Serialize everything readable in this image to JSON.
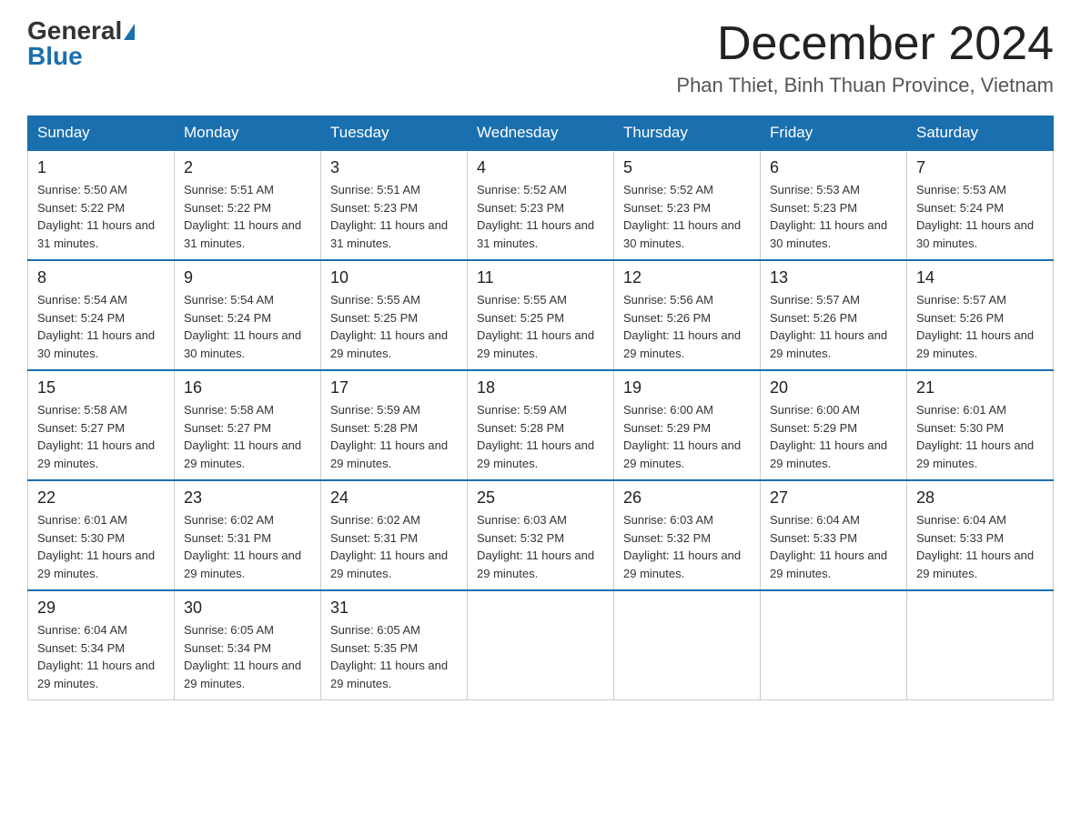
{
  "header": {
    "logo_general": "General",
    "logo_blue": "Blue",
    "month_title": "December 2024",
    "location": "Phan Thiet, Binh Thuan Province, Vietnam"
  },
  "days_of_week": [
    "Sunday",
    "Monday",
    "Tuesday",
    "Wednesday",
    "Thursday",
    "Friday",
    "Saturday"
  ],
  "weeks": [
    [
      {
        "day": "1",
        "sunrise": "5:50 AM",
        "sunset": "5:22 PM",
        "daylight": "11 hours and 31 minutes."
      },
      {
        "day": "2",
        "sunrise": "5:51 AM",
        "sunset": "5:22 PM",
        "daylight": "11 hours and 31 minutes."
      },
      {
        "day": "3",
        "sunrise": "5:51 AM",
        "sunset": "5:23 PM",
        "daylight": "11 hours and 31 minutes."
      },
      {
        "day": "4",
        "sunrise": "5:52 AM",
        "sunset": "5:23 PM",
        "daylight": "11 hours and 31 minutes."
      },
      {
        "day": "5",
        "sunrise": "5:52 AM",
        "sunset": "5:23 PM",
        "daylight": "11 hours and 30 minutes."
      },
      {
        "day": "6",
        "sunrise": "5:53 AM",
        "sunset": "5:23 PM",
        "daylight": "11 hours and 30 minutes."
      },
      {
        "day": "7",
        "sunrise": "5:53 AM",
        "sunset": "5:24 PM",
        "daylight": "11 hours and 30 minutes."
      }
    ],
    [
      {
        "day": "8",
        "sunrise": "5:54 AM",
        "sunset": "5:24 PM",
        "daylight": "11 hours and 30 minutes."
      },
      {
        "day": "9",
        "sunrise": "5:54 AM",
        "sunset": "5:24 PM",
        "daylight": "11 hours and 30 minutes."
      },
      {
        "day": "10",
        "sunrise": "5:55 AM",
        "sunset": "5:25 PM",
        "daylight": "11 hours and 29 minutes."
      },
      {
        "day": "11",
        "sunrise": "5:55 AM",
        "sunset": "5:25 PM",
        "daylight": "11 hours and 29 minutes."
      },
      {
        "day": "12",
        "sunrise": "5:56 AM",
        "sunset": "5:26 PM",
        "daylight": "11 hours and 29 minutes."
      },
      {
        "day": "13",
        "sunrise": "5:57 AM",
        "sunset": "5:26 PM",
        "daylight": "11 hours and 29 minutes."
      },
      {
        "day": "14",
        "sunrise": "5:57 AM",
        "sunset": "5:26 PM",
        "daylight": "11 hours and 29 minutes."
      }
    ],
    [
      {
        "day": "15",
        "sunrise": "5:58 AM",
        "sunset": "5:27 PM",
        "daylight": "11 hours and 29 minutes."
      },
      {
        "day": "16",
        "sunrise": "5:58 AM",
        "sunset": "5:27 PM",
        "daylight": "11 hours and 29 minutes."
      },
      {
        "day": "17",
        "sunrise": "5:59 AM",
        "sunset": "5:28 PM",
        "daylight": "11 hours and 29 minutes."
      },
      {
        "day": "18",
        "sunrise": "5:59 AM",
        "sunset": "5:28 PM",
        "daylight": "11 hours and 29 minutes."
      },
      {
        "day": "19",
        "sunrise": "6:00 AM",
        "sunset": "5:29 PM",
        "daylight": "11 hours and 29 minutes."
      },
      {
        "day": "20",
        "sunrise": "6:00 AM",
        "sunset": "5:29 PM",
        "daylight": "11 hours and 29 minutes."
      },
      {
        "day": "21",
        "sunrise": "6:01 AM",
        "sunset": "5:30 PM",
        "daylight": "11 hours and 29 minutes."
      }
    ],
    [
      {
        "day": "22",
        "sunrise": "6:01 AM",
        "sunset": "5:30 PM",
        "daylight": "11 hours and 29 minutes."
      },
      {
        "day": "23",
        "sunrise": "6:02 AM",
        "sunset": "5:31 PM",
        "daylight": "11 hours and 29 minutes."
      },
      {
        "day": "24",
        "sunrise": "6:02 AM",
        "sunset": "5:31 PM",
        "daylight": "11 hours and 29 minutes."
      },
      {
        "day": "25",
        "sunrise": "6:03 AM",
        "sunset": "5:32 PM",
        "daylight": "11 hours and 29 minutes."
      },
      {
        "day": "26",
        "sunrise": "6:03 AM",
        "sunset": "5:32 PM",
        "daylight": "11 hours and 29 minutes."
      },
      {
        "day": "27",
        "sunrise": "6:04 AM",
        "sunset": "5:33 PM",
        "daylight": "11 hours and 29 minutes."
      },
      {
        "day": "28",
        "sunrise": "6:04 AM",
        "sunset": "5:33 PM",
        "daylight": "11 hours and 29 minutes."
      }
    ],
    [
      {
        "day": "29",
        "sunrise": "6:04 AM",
        "sunset": "5:34 PM",
        "daylight": "11 hours and 29 minutes."
      },
      {
        "day": "30",
        "sunrise": "6:05 AM",
        "sunset": "5:34 PM",
        "daylight": "11 hours and 29 minutes."
      },
      {
        "day": "31",
        "sunrise": "6:05 AM",
        "sunset": "5:35 PM",
        "daylight": "11 hours and 29 minutes."
      },
      null,
      null,
      null,
      null
    ]
  ]
}
